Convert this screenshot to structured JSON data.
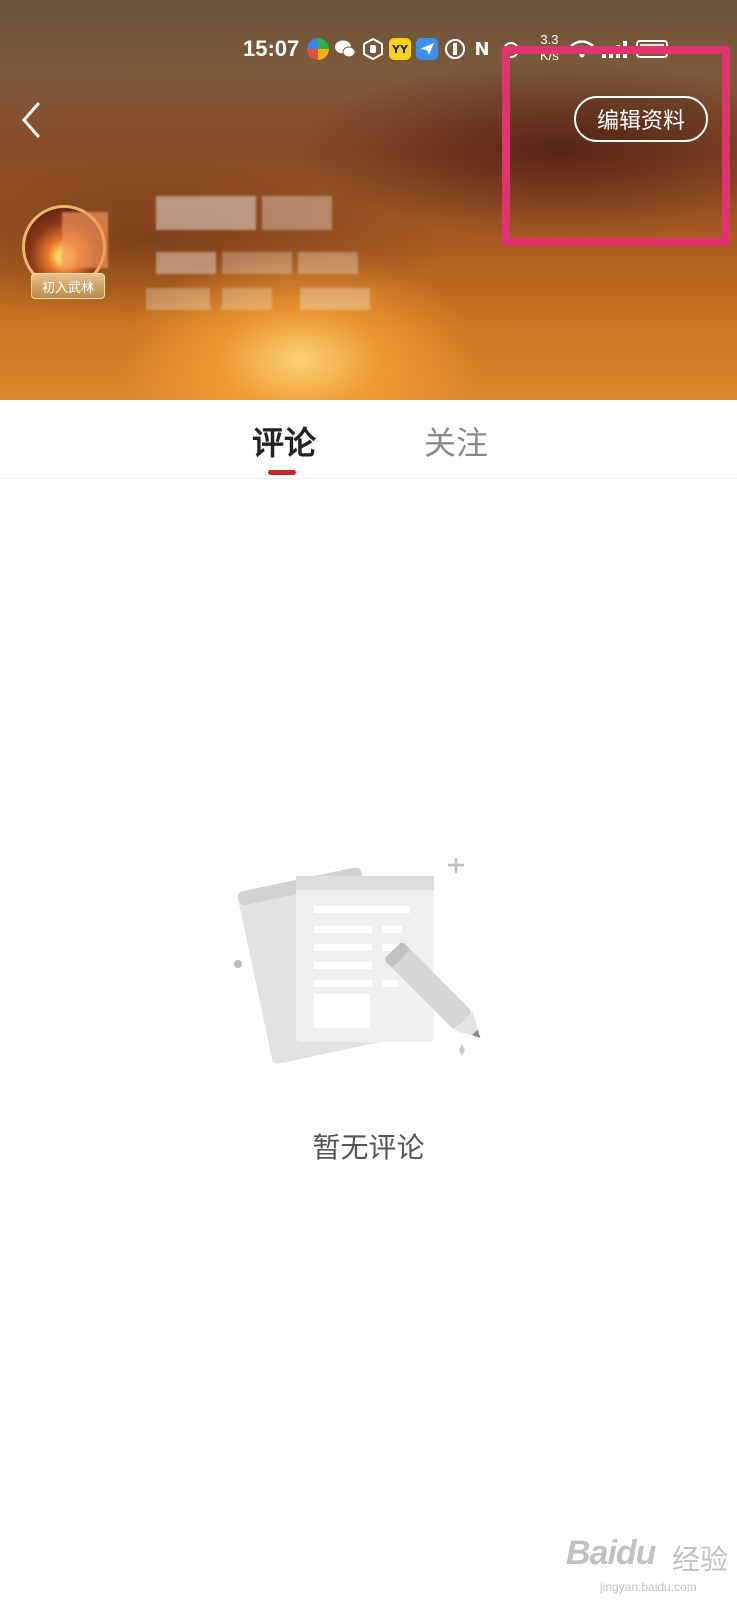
{
  "status_bar": {
    "time": "15:07",
    "net_speed_value": "3.3",
    "net_speed_unit": "K/s",
    "icons": [
      "maps-app-icon",
      "wechat-icon",
      "hand-app-icon",
      "yy-app-icon",
      "bird-app-icon",
      "app-icon",
      "nfc-icon",
      "alarm-icon",
      "wifi-icon",
      "signal-icon",
      "battery-icon"
    ],
    "yy_label": "YY"
  },
  "header": {
    "back_icon": "chevron-left-icon",
    "edit_button_label": "编辑资料",
    "badge_label": "初入武林",
    "highlight_color": "#e0336f"
  },
  "tabs": [
    {
      "label": "评论",
      "active": true
    },
    {
      "label": "关注",
      "active": false
    }
  ],
  "accent_color": "#c6272a",
  "empty_state": {
    "icon": "document-pencil-icon",
    "text": "暂无评论"
  },
  "watermark": {
    "logo": "Baidu",
    "cn": "经验",
    "url": "jingyan.baidu.com"
  }
}
